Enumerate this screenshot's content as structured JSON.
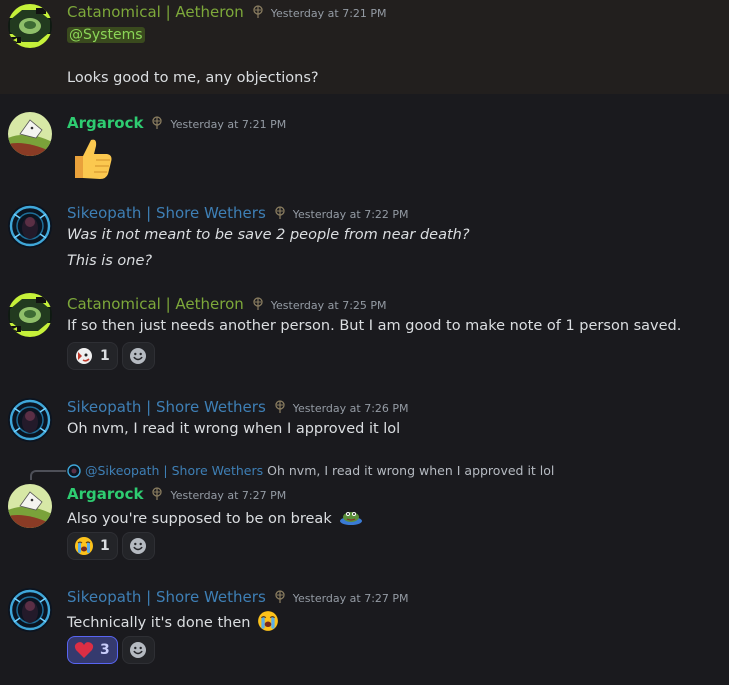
{
  "messages": [
    {
      "user": "Catanomical | Aetheron",
      "time": "Yesterday at 7:21 PM",
      "mention": "@Systems",
      "text": "Looks good to me, any objections?"
    },
    {
      "user": "Argarock",
      "time": "Yesterday at 7:21 PM",
      "emoji": "thumbs-up"
    },
    {
      "user": "Sikeopath | Shore Wethers",
      "time": "Yesterday at 7:22 PM",
      "lines": [
        "Was it not meant to be save 2 people from near death?",
        "This is one?"
      ]
    },
    {
      "user": "Catanomical | Aetheron",
      "time": "Yesterday at 7:25 PM",
      "text": "If so then just needs another person. But I am good to make note of 1 person saved.",
      "reactions": [
        {
          "icon": "custom-emoji",
          "count": "1"
        }
      ]
    },
    {
      "user": "Sikeopath | Shore Wethers",
      "time": "Yesterday at 7:26 PM",
      "text": "Oh nvm, I read it wrong when I approved it lol"
    },
    {
      "reply": {
        "user": "@Sikeopath | Shore Wethers",
        "text": "Oh nvm, I read it wrong when I approved it lol"
      },
      "user": "Argarock",
      "time": "Yesterday at 7:27 PM",
      "text": "Also you're supposed to be on break",
      "reactions": [
        {
          "icon": "sob-emoji",
          "count": "1"
        }
      ]
    },
    {
      "user": "Sikeopath | Shore Wethers",
      "time": "Yesterday at 7:27 PM",
      "text": "Technically it's done then",
      "reactions": [
        {
          "icon": "heart-emoji",
          "count": "3",
          "active": true
        }
      ]
    }
  ]
}
